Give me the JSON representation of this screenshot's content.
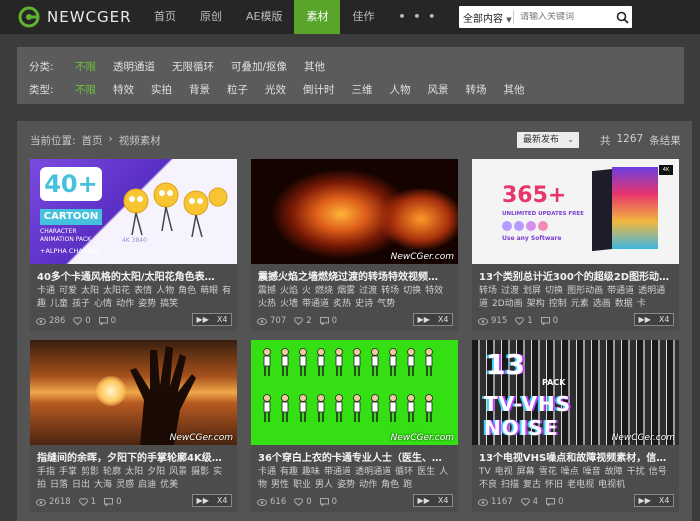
{
  "header": {
    "logo_text": "NEWCGER",
    "nav": [
      {
        "label": "首页",
        "active": false
      },
      {
        "label": "原创",
        "active": false
      },
      {
        "label": "AE模版",
        "active": false
      },
      {
        "label": "素材",
        "active": true
      },
      {
        "label": "佳作",
        "active": false
      },
      {
        "label": "• • •",
        "active": false
      }
    ],
    "search": {
      "scope": "全部内容",
      "placeholder": "请输入关键词"
    }
  },
  "filters": {
    "category_label": "分类:",
    "categories": [
      "不限",
      "透明通道",
      "无限循环",
      "可叠加/抠像",
      "其他"
    ],
    "type_label": "类型:",
    "types": [
      "不限",
      "特效",
      "实拍",
      "背景",
      "粒子",
      "光效",
      "倒计时",
      "三维",
      "人物",
      "风景",
      "转场",
      "其他"
    ]
  },
  "crumb": {
    "label": "当前位置:",
    "home": "首页",
    "sep": "›",
    "current": "视频素材"
  },
  "sort": {
    "selected": "最新发布"
  },
  "count": {
    "prefix": "共",
    "value": "1267",
    "suffix": "条结果"
  },
  "cards": [
    {
      "title": "40多个卡通风格的太阳/太阳花角色表…",
      "tags": [
        "卡通",
        "可爱",
        "太阳",
        "太阳花",
        "表情",
        "人物",
        "角色",
        "萌眼",
        "有趣",
        "儿童",
        "孩子",
        "心情",
        "动作",
        "姿势",
        "搞笑"
      ],
      "views": "286",
      "likes": "0",
      "comments": "0",
      "play": "X4",
      "watermark": ""
    },
    {
      "title": "震撼火焰之墙燃烧过渡的转场特效视频…",
      "tags": [
        "震撼",
        "火焰",
        "火",
        "燃烧",
        "烟雾",
        "过渡",
        "转场",
        "切换",
        "特效",
        "火热",
        "火墙",
        "带通道",
        "炙热",
        "史诗",
        "气势"
      ],
      "views": "707",
      "likes": "2",
      "comments": "0",
      "play": "X4",
      "watermark": "NewCGer.com"
    },
    {
      "title": "13个类别总计近300个的超级2D图形动…",
      "tags": [
        "转场",
        "过渡",
        "划屏",
        "切换",
        "图形动画",
        "带通道",
        "透明通道",
        "2D动画",
        "架构",
        "控制",
        "元素",
        "选画",
        "数据",
        "卡"
      ],
      "views": "915",
      "likes": "1",
      "comments": "0",
      "play": "X4",
      "watermark": ""
    },
    {
      "title": "指缝间的余晖，夕阳下的手掌轮廓4K级…",
      "tags": [
        "手指",
        "手掌",
        "剪影",
        "轮廓",
        "太阳",
        "夕阳",
        "风景",
        "摄影",
        "实拍",
        "日落",
        "日出",
        "大海",
        "灵感",
        "启迪",
        "优美"
      ],
      "views": "2618",
      "likes": "1",
      "comments": "0",
      "play": "X4",
      "watermark": "NewCGer.com"
    },
    {
      "title": "36个穿白上衣的卡通专业人士（医生、…",
      "tags": [
        "卡通",
        "有趣",
        "趣味",
        "带通道",
        "透明通道",
        "循环",
        "医生",
        "人物",
        "男性",
        "职业",
        "男人",
        "姿势",
        "动作",
        "角色",
        "跑"
      ],
      "views": "616",
      "likes": "0",
      "comments": "0",
      "play": "X4",
      "watermark": "NewCGer.com"
    },
    {
      "title": "13个电视VHS噪点和故障视频素材，信…",
      "tags": [
        "TV",
        "电视",
        "屏幕",
        "雪花",
        "噪点",
        "噪音",
        "故障",
        "干扰",
        "信号不良",
        "扫描",
        "复古",
        "怀旧",
        "老电视",
        "电视机"
      ],
      "views": "1167",
      "likes": "4",
      "comments": "0",
      "play": "X4",
      "watermark": "NewCGer.com"
    }
  ],
  "thumb_text": {
    "c1_big": "40+",
    "c1_cartoon": "CARTOON",
    "c1_sub": "CHARACTER ANIMATION PACK",
    "c1_alpha": "+ALPHA CHANNEL",
    "c1_res": "4K 3840",
    "c3_big": "365+",
    "c3_sub": "UNLIMITED UPDATES FREE",
    "c3_use": "Use any Software",
    "c6_num": "13",
    "c6_pack": "PACK",
    "c6_title1": "TV-VHS",
    "c6_title2": "NOISE"
  },
  "colors": {
    "accent": "#59a52c",
    "active_filter": "#6cc23a",
    "page_bg": "#3c3c3c"
  }
}
